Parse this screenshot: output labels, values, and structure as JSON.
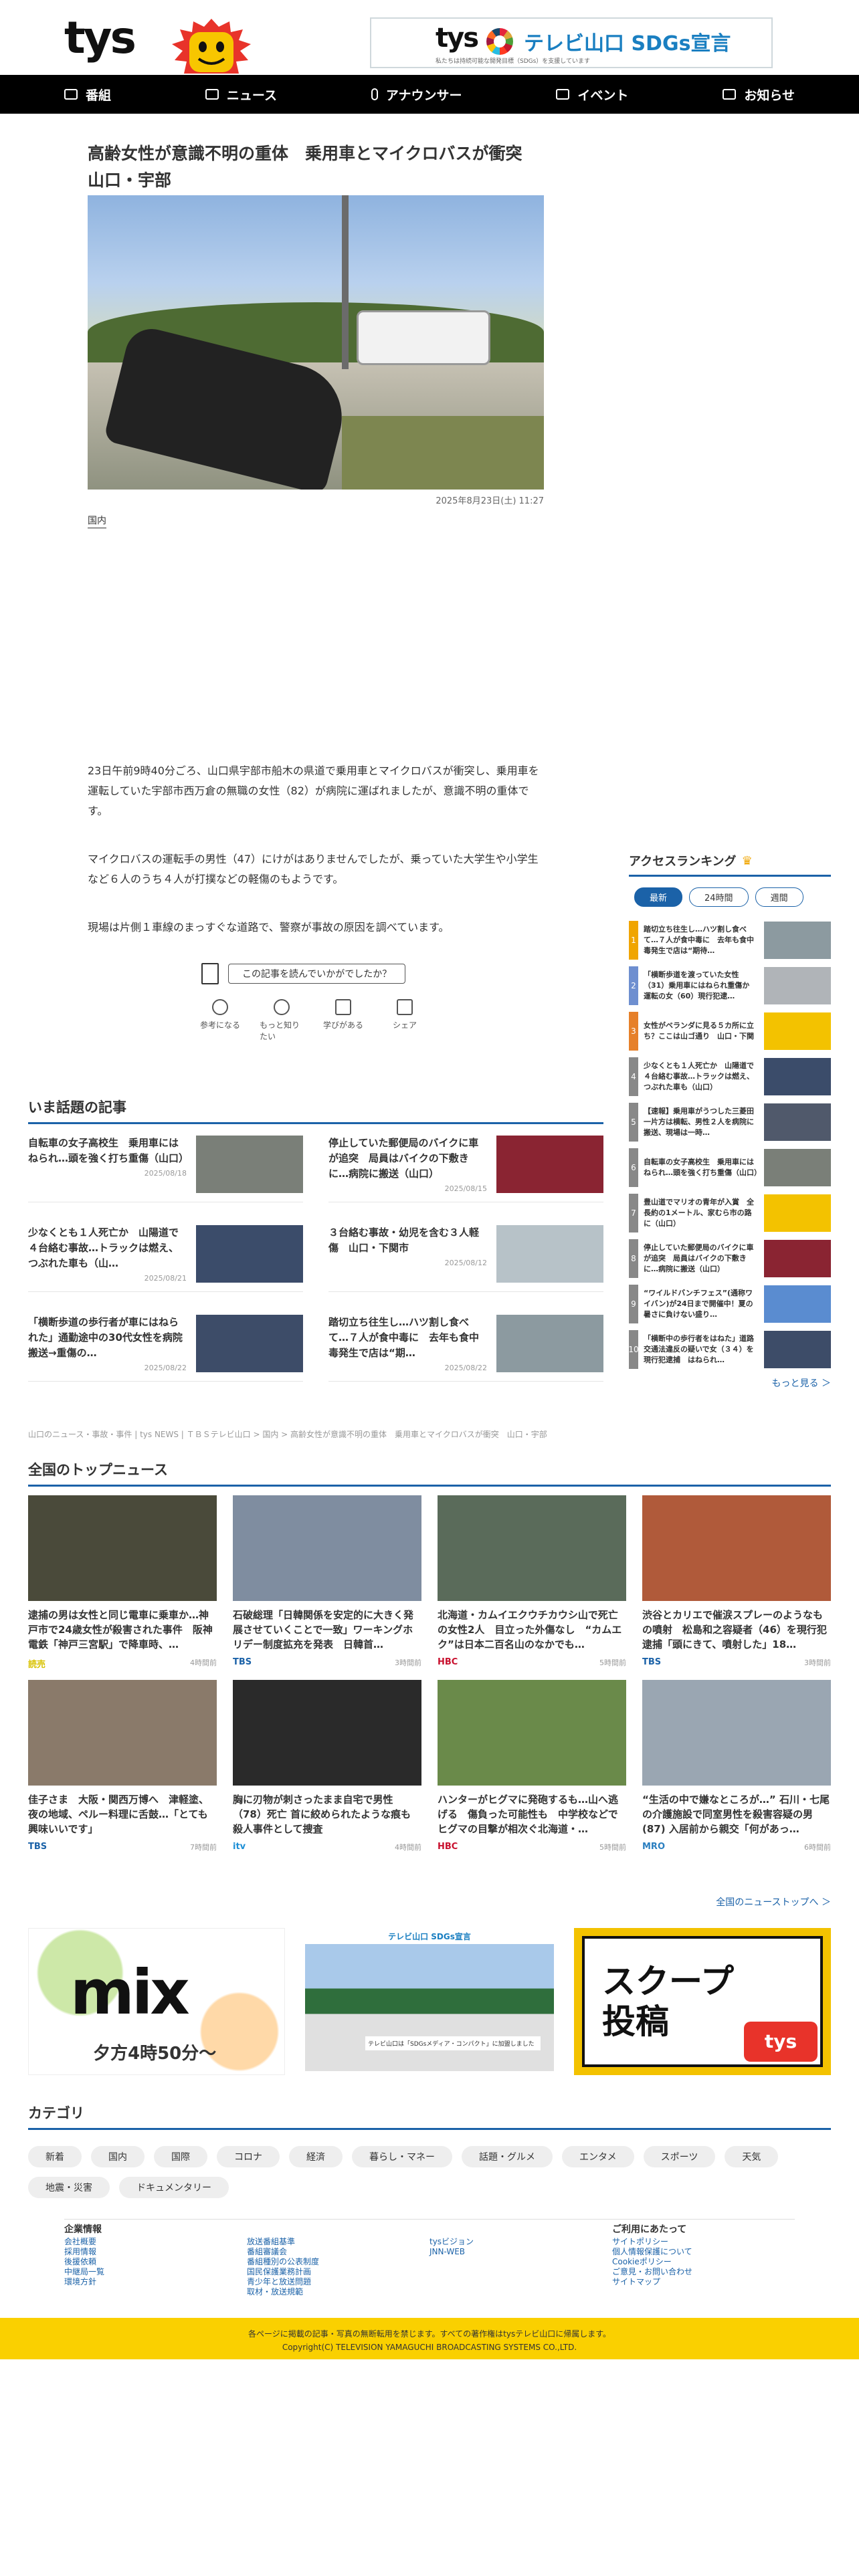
{
  "header": {
    "logo": "tys",
    "sdgs_logo": "tys",
    "sdgs_title": "テレビ山口 SDGs宣言",
    "sdgs_sub": "私たちは持続可能な開発目標（SDGs）を支援しています"
  },
  "nav": [
    {
      "label": "番組",
      "icon": "tv-icon"
    },
    {
      "label": "ニュース",
      "icon": "news-icon"
    },
    {
      "label": "アナウンサー",
      "icon": "mic-icon"
    },
    {
      "label": "イベント",
      "icon": "megaphone-icon"
    },
    {
      "label": "お知らせ",
      "icon": "mail-icon"
    }
  ],
  "article": {
    "headline": "高齢女性が意識不明の重体　乗用車とマイクロバスが衝突　山口・宇部",
    "date": "2025年8月23日(土) 11:27",
    "category": "国内",
    "paragraphs": [
      "23日午前9時40分ごろ、山口県宇部市船木の県道で乗用車とマイクロバスが衝突し、乗用車を運転していた宇部市西万倉の無職の女性（82）が病院に運ばれましたが、意識不明の重体です。",
      "マイクロバスの運転手の男性（47）にけがはありませんでしたが、乗っていた大学生や小学生など６人のうち４人が打撲などの軽傷のもようです。",
      "現場は片側１車線のまっすぐな道路で、警察が事故の原因を調べています。"
    ],
    "reaction_question": "この記事を読んでいかがでしたか？",
    "reactions": [
      "参考になる",
      "もっと知りたい",
      "学びがある",
      "シェア"
    ]
  },
  "hot_topics": {
    "title": "いま話題の記事",
    "items": [
      {
        "title": "自転車の女子高校生　乗用車にはねられ…頭を強く打ち重傷（山口）",
        "date": "2025/08/18",
        "color": "#7a7f78"
      },
      {
        "title": "停止していた郵便局のバイクに車が追突　局員はバイクの下敷きに…病院に搬送（山口）",
        "date": "2025/08/15",
        "color": "#8a2432"
      },
      {
        "title": "少なくとも１人死亡か　山陽道で４台絡む事故…トラックは燃え、つぶれた車も（山…",
        "date": "2025/08/21",
        "color": "#3b4c6a"
      },
      {
        "title": "３台絡む事故・幼児を含む３人軽傷　山口・下関市",
        "date": "2025/08/12",
        "color": "#b7c2c8"
      },
      {
        "title": "「横断歩道の歩行者が車にはねられた」通勤途中の30代女性を病院搬送→重傷の…",
        "date": "2025/08/22",
        "color": "#3d4c68"
      },
      {
        "title": "踏切立ち往生し…ハツ割し食べて…７人が食中毒に　去年も食中毒発生で店は“期…",
        "date": "2025/08/22",
        "color": "#8c9aa0"
      }
    ]
  },
  "breadcrumb": "山口のニュース・事故・事件 | tys NEWS | ＴＢＳテレビ山口 > 国内 > 高齢女性が意識不明の重体　乗用車とマイクロバスが衝突　山口・宇部",
  "ranking": {
    "title": "アクセスランキング",
    "tabs": [
      "最新",
      "24時間",
      "週間"
    ],
    "items": [
      {
        "no": "1",
        "title": "踏切立ち往生し…ハツ割し食べて…７人が食中毒に　去年も食中毒発生で店は“期待…",
        "color": "#f0a500",
        "thumb": "#8c9aa0"
      },
      {
        "no": "2",
        "title": "「横断歩道を渡っていた女性（31）乗用車にはねられ重傷か　運転の女（60）現行犯逮…",
        "color": "#6e8fd0",
        "thumb": "#b0b4b8"
      },
      {
        "no": "3",
        "title": "女性がベランダに見る５カ所に立ち？ここは山ゴ通り　山口・下関",
        "color": "#e6802a",
        "thumb": "#f3c200"
      },
      {
        "no": "4",
        "title": "少なくとも１人死亡か　山陽道で４台絡む事故…トラックは燃え、つぶれた車も（山口）",
        "color": "#888",
        "thumb": "#3b4c6a"
      },
      {
        "no": "5",
        "title": "【速報】乗用車がうつした三菱田一片方は横転、男性２人を病院に搬送、現場は一時…",
        "color": "#888",
        "thumb": "#50596b"
      },
      {
        "no": "6",
        "title": "自転車の女子高校生　乗用車にはねられ…頭を強く打ち重傷（山口）",
        "color": "#888",
        "thumb": "#7a7f78"
      },
      {
        "no": "7",
        "title": "豊山道でマリオの青年が入賞　全長約の1メートル、家むら市の路に（山口）",
        "color": "#888",
        "thumb": "#f3c200"
      },
      {
        "no": "8",
        "title": "停止していた郵便局のバイクに車が追突　局員はバイクの下敷きに…病院に搬送（山口）",
        "color": "#888",
        "thumb": "#8a2432"
      },
      {
        "no": "9",
        "title": "“ワイルドバンチフェス”(通称ワイバン)が24日まで開催中！夏の暑さに負けない盛り…",
        "color": "#888",
        "thumb": "#5a8cd0"
      },
      {
        "no": "10",
        "title": "「横断中の歩行者をはねた」道路交通法違反の疑いで女（３４）を現行犯逮捕　はねられ…",
        "color": "#888",
        "thumb": "#3d4c68"
      }
    ],
    "more": "もっと見る ＞"
  },
  "top_news": {
    "title": "全国のトップニュース",
    "items": [
      {
        "title": "逮捕の男は女性と同じ電車に乗車か…神戸市で24歳女性が殺害された事件　阪神電鉄「神戸三宮駅」で降車時、…",
        "source": "読売",
        "src_color": "#d8c200",
        "time": "4時間前",
        "color": "#4a4a3a"
      },
      {
        "title": "石破総理「日韓関係を安定的に大きく発展させていくことで一致」ワーキングホリデー制度拡充を発表　日韓首…",
        "source": "TBS",
        "src_color": "#1b62a8",
        "time": "3時間前",
        "color": "#7f8da0"
      },
      {
        "title": "北海道・カムイエクウチカウシ山で死亡の女性2人　目立った外傷なし　“カムエク”は日本二百名山のなかでも…",
        "source": "HBC",
        "src_color": "#c8102e",
        "time": "5時間前",
        "color": "#5a6b5a"
      },
      {
        "title": "渋谷とカリエで催涙スプレーのようなもの噴射　松島和之容疑者（46）を現行犯逮捕「頭にきて、噴射した」18…",
        "source": "TBS",
        "src_color": "#1b62a8",
        "time": "3時間前",
        "color": "#b05a3a"
      },
      {
        "title": "佳子さま　大阪・関西万博へ　津軽塗、夜の地域、ペルー料理に舌鼓…「とても興味いいです」",
        "source": "TBS",
        "src_color": "#1b62a8",
        "time": "7時間前",
        "color": "#8a7a6a"
      },
      {
        "title": "胸に刃物が刺さったまま自宅で男性（78）死亡 首に絞められたような痕も 殺人事件として捜査",
        "source": "itv",
        "src_color": "#1d8fd6",
        "time": "4時間前",
        "color": "#2a2a2a"
      },
      {
        "title": "ハンターがヒグマに発砲するも…山へ逃げる　傷負った可能性も　中学校などでヒグマの目撃が相次ぐ北海道・…",
        "source": "HBC",
        "src_color": "#c8102e",
        "time": "5時間前",
        "color": "#6a8a4a"
      },
      {
        "title": "“生活の中で嫌なところが…” 石川・七尾の介護施設で同室男性を殺害容疑の男(87) 入居前から親交「何があっ…",
        "source": "MRO",
        "src_color": "#2a7fc0",
        "time": "6時間前",
        "color": "#9aa6b2"
      }
    ],
    "all": "全国のニューストップへ ＞"
  },
  "banners": {
    "mix": "mix",
    "mix_sub": "夕方4時50分〜",
    "sdgs_title": "テレビ山口 SDGs宣言",
    "sdgs_cap": "テレビ山口は「SDGsメディア・コンパクト」に加盟しました",
    "scoop": "スクープ投稿",
    "scoop_logo": "tys"
  },
  "categories": {
    "title": "カテゴリ",
    "items": [
      "新着",
      "国内",
      "国際",
      "コロナ",
      "経済",
      "暮らし・マネー",
      "話題・グルメ",
      "エンタメ",
      "スポーツ",
      "天気",
      "地震・災害",
      "ドキュメンタリー"
    ]
  },
  "footer_cols": [
    {
      "head": "企業情報",
      "links": [
        "会社概要",
        "採用情報",
        "後援依頼",
        "中継局一覧",
        "環境方針"
      ]
    },
    {
      "head": "",
      "links": [
        "放送番組基準",
        "番組審議会",
        "番組種別の公表制度",
        "国民保護業務計画",
        "青少年と放送問題",
        "取材・放送規範"
      ]
    },
    {
      "head": "",
      "links": [
        "tysビジョン",
        "JNN-WEB"
      ]
    },
    {
      "head": "ご利用にあたって",
      "links": [
        "サイトポリシー",
        "個人情報保護について",
        "Cookieポリシー",
        "ご意見・お問い合わせ",
        "サイトマップ"
      ]
    }
  ],
  "footer": {
    "notice": "各ページに掲載の記事・写真の無断転用を禁じます。すべての著作権はtysテレビ山口に帰属します。",
    "copyright": "Copyright(C) TELEVISION YAMAGUCHI BROADCASTING SYSTEMS CO.,LTD."
  }
}
